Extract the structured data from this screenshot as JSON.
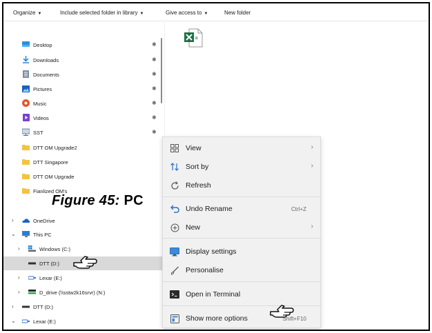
{
  "toolbar": {
    "organize": "Organize",
    "include_library": "Include selected folder in library",
    "give_access": "Give access to",
    "new_folder": "New folder"
  },
  "quick_access": [
    {
      "label": "Desktop",
      "icon": "desktop-icon",
      "pinned": true
    },
    {
      "label": "Downloads",
      "icon": "download-icon",
      "pinned": true
    },
    {
      "label": "Documents",
      "icon": "documents-icon",
      "pinned": true
    },
    {
      "label": "Pictures",
      "icon": "pictures-icon",
      "pinned": true
    },
    {
      "label": "Music",
      "icon": "music-icon",
      "pinned": true
    },
    {
      "label": "Videos",
      "icon": "videos-icon",
      "pinned": true
    },
    {
      "label": "SST",
      "icon": "network-folder-icon",
      "pinned": true
    },
    {
      "label": "DTT OM Upgrade2",
      "icon": "folder-icon",
      "pinned": false
    },
    {
      "label": "DTT Singapore",
      "icon": "folder-icon",
      "pinned": false
    },
    {
      "label": "DTT OM Upgrade",
      "icon": "folder-icon",
      "pinned": false
    },
    {
      "label": "Fianlized OM's",
      "icon": "folder-icon",
      "pinned": false
    }
  ],
  "tree": [
    {
      "label": "OneDrive",
      "icon": "cloud-icon",
      "expand": "collapsed"
    },
    {
      "label": "This PC",
      "icon": "pc-icon",
      "expand": "expanded"
    },
    {
      "label": "Windows (C:)",
      "icon": "windows-drive-icon",
      "expand": "collapsed"
    },
    {
      "label": "DTT (D:)",
      "icon": "drive-icon",
      "expand": "none",
      "selected": true
    },
    {
      "label": "Lexar (E:)",
      "icon": "usb-drive-icon",
      "expand": "collapsed"
    },
    {
      "label": "D_drive (\\\\sstw2k16srvr) (N:)",
      "icon": "network-drive-icon",
      "expand": "collapsed"
    },
    {
      "label": "DTT (D:)",
      "icon": "drive-icon",
      "expand": "collapsed"
    },
    {
      "label": "Lexar (E:)",
      "icon": "usb-drive-icon",
      "expand": "expanded"
    }
  ],
  "caption": {
    "figure": "Figure 45:",
    "pc": "PC"
  },
  "context_menu": {
    "items": [
      {
        "label": "View",
        "icon": "view-grid-icon",
        "submenu": true
      },
      {
        "label": "Sort by",
        "icon": "sort-icon",
        "submenu": true
      },
      {
        "label": "Refresh",
        "icon": "refresh-icon",
        "submenu": false
      },
      {
        "label": "Undo Rename",
        "icon": "undo-icon",
        "shortcut": "Ctrl+Z"
      },
      {
        "label": "New",
        "icon": "new-icon",
        "submenu": true
      },
      {
        "label": "Display settings",
        "icon": "display-icon",
        "submenu": false
      },
      {
        "label": "Personalise",
        "icon": "brush-icon",
        "submenu": false
      },
      {
        "label": "Open in Terminal",
        "icon": "terminal-icon",
        "submenu": false
      },
      {
        "label": "Show more options",
        "icon": "more-options-icon",
        "shortcut": "Shift+F10"
      }
    ]
  },
  "file": {
    "icon": "excel-file-icon"
  },
  "colors": {
    "accent": "#0078d4",
    "folder": "#f5c242",
    "excel": "#1d7044",
    "selected_bg": "#d9d9d9",
    "menu_bg": "#f1f1f1"
  }
}
